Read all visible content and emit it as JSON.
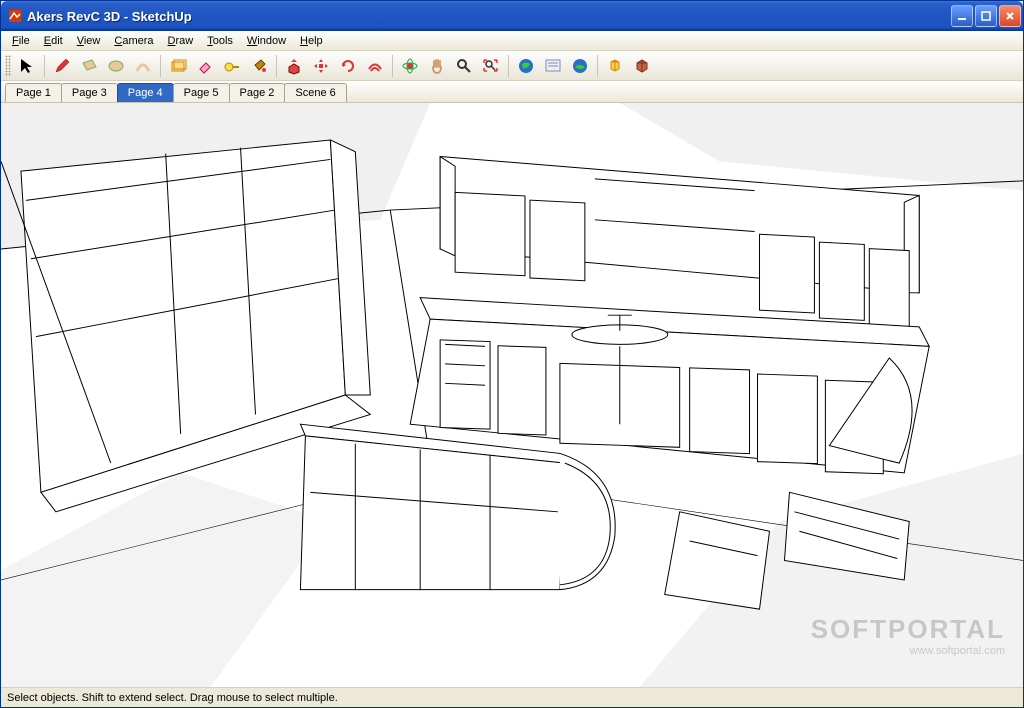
{
  "window": {
    "title": "Akers RevC 3D - SketchUp"
  },
  "menus": [
    {
      "label": "File",
      "accel": "F"
    },
    {
      "label": "Edit",
      "accel": "E"
    },
    {
      "label": "View",
      "accel": "V"
    },
    {
      "label": "Camera",
      "accel": "C"
    },
    {
      "label": "Draw",
      "accel": "D"
    },
    {
      "label": "Tools",
      "accel": "T"
    },
    {
      "label": "Window",
      "accel": "W"
    },
    {
      "label": "Help",
      "accel": "H"
    }
  ],
  "toolbar": [
    {
      "name": "select-tool"
    },
    {
      "sep": true
    },
    {
      "name": "pencil-tool"
    },
    {
      "name": "rectangle-tool"
    },
    {
      "name": "circle-tool"
    },
    {
      "name": "arc-tool"
    },
    {
      "sep": true
    },
    {
      "name": "make-component-tool"
    },
    {
      "name": "eraser-tool"
    },
    {
      "name": "tape-measure-tool"
    },
    {
      "name": "paint-bucket-tool"
    },
    {
      "sep": true
    },
    {
      "name": "push-pull-tool"
    },
    {
      "name": "move-tool"
    },
    {
      "name": "rotate-tool"
    },
    {
      "name": "offset-tool"
    },
    {
      "sep": true
    },
    {
      "name": "orbit-tool"
    },
    {
      "name": "pan-tool"
    },
    {
      "name": "zoom-tool"
    },
    {
      "name": "zoom-extents-tool"
    },
    {
      "sep": true
    },
    {
      "name": "get-current-view-tool"
    },
    {
      "name": "model-info-tool"
    },
    {
      "name": "toggle-terrain-tool"
    },
    {
      "sep": true
    },
    {
      "name": "get-models-tool"
    },
    {
      "name": "share-model-tool"
    }
  ],
  "scenes": {
    "tabs": [
      {
        "label": "Page 1"
      },
      {
        "label": "Page 3"
      },
      {
        "label": "Page 4"
      },
      {
        "label": "Page 5"
      },
      {
        "label": "Page 2"
      },
      {
        "label": "Scene 6"
      }
    ],
    "active_index": 2
  },
  "statusbar": {
    "hint": "Select objects. Shift to extend select. Drag mouse to select multiple."
  },
  "watermark": {
    "brand": "SOFTPORTAL",
    "url": "www.softportal.com"
  }
}
